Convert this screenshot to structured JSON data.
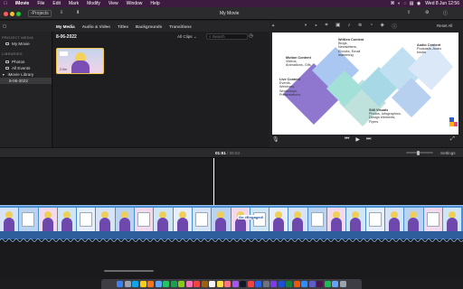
{
  "menubar": {
    "apple": "",
    "items": [
      "iMovie",
      "File",
      "Edit",
      "Mark",
      "Modify",
      "View",
      "Window",
      "Help"
    ],
    "datetime": "Wed 8 Jun  12:56"
  },
  "toolbar": {
    "back_label": "Projects",
    "title": "My Movie",
    "reset_label": "Reset All"
  },
  "browser": {
    "tabs": [
      "My Media",
      "Audio & Video",
      "Titles",
      "Backgrounds",
      "Transitions"
    ],
    "active_tab": "My Media",
    "event_date": "8-06-2022",
    "filter_label": "All Clips",
    "search_placeholder": "Search",
    "clip_duration": "2.0m"
  },
  "sidebar": {
    "project_media_header": "PROJECT MEDIA",
    "project": "My Movie",
    "libraries_header": "LIBRARIES",
    "items": [
      "Photos",
      "All Events",
      "iMovie Library",
      "8-06-2022"
    ]
  },
  "viewer": {
    "cards": [
      {
        "title": "Motion Content",
        "body": "Videos, Animations, Gifs"
      },
      {
        "title": "Written Content",
        "body": "Blogs, Newsletters, Ebooks, Email marketing"
      },
      {
        "title": "Audio Content",
        "body": "Podcasts, Audio books"
      },
      {
        "title": "Live Content",
        "body": "Events, Webinars, Workshops, Presentations"
      },
      {
        "title": "Still Visuals",
        "body": "Photos, Infographics, Design elements, Flyers"
      }
    ]
  },
  "timeline": {
    "current_time": "01:51",
    "separator": "/",
    "total_time": "06:53",
    "settings_label": "Settings",
    "overlay_text": "Go #Engaged!"
  },
  "colors": {
    "menubar_bg": "#3d1a3f",
    "clip_strip": "#4a8ed0",
    "audio_waveform": "#2f5e9c",
    "playhead": "#ffffff"
  },
  "dock": {
    "icons": [
      "finder-icon",
      "launchpad-icon",
      "safari-icon",
      "chrome-icon",
      "firefox-icon",
      "mail-icon",
      "messages-icon",
      "facetime-icon",
      "maps-icon",
      "photos-icon",
      "calendar-icon",
      "contacts-icon",
      "reminders-icon",
      "notes-icon",
      "music-icon",
      "podcasts-icon",
      "tv-icon",
      "news-icon",
      "appstore-icon",
      "settings-icon",
      "imovie-icon",
      "word-icon",
      "excel-icon",
      "powerpoint-icon",
      "zoom-icon",
      "teams-icon",
      "slack-icon",
      "spotify-icon",
      "downloads-icon",
      "trash-icon"
    ]
  }
}
